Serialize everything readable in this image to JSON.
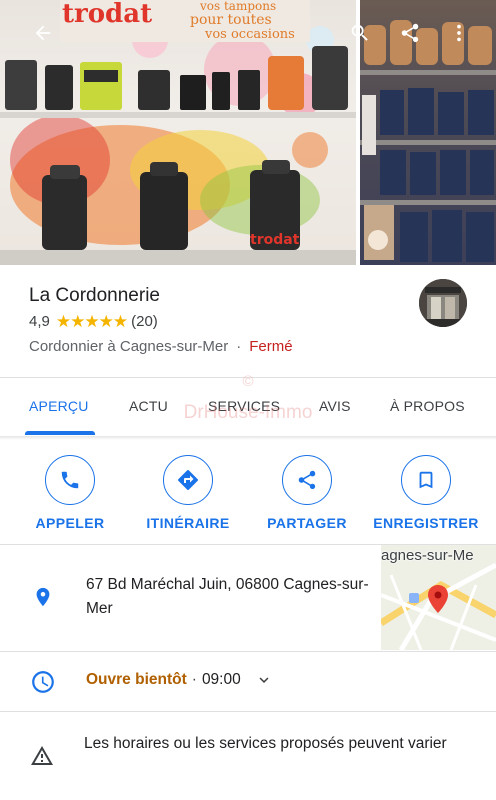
{
  "photos": {
    "sign_brand": "trodat",
    "sign_line1": "vos tampons",
    "sign_line2": "pour toutes",
    "sign_line3": "vos occasions",
    "bottom_brand": "trodat"
  },
  "place": {
    "name": "La Cordonnerie",
    "rating": "4,9",
    "stars": 5,
    "review_count": "(20)",
    "category": "Cordonnier à Cagnes-sur-Mer",
    "separator": "·",
    "status": "Fermé"
  },
  "tabs": [
    {
      "label": "APERÇU",
      "active": true
    },
    {
      "label": "ACTU",
      "active": false
    },
    {
      "label": "SERVICES",
      "active": false
    },
    {
      "label": "AVIS",
      "active": false
    },
    {
      "label": "À PROPOS",
      "active": false
    }
  ],
  "watermark": {
    "symbol": "©",
    "text": "DrHouse-Immo"
  },
  "actions": [
    {
      "label": "APPELER",
      "icon": "phone-icon"
    },
    {
      "label": "ITINÉRAIRE",
      "icon": "directions-icon"
    },
    {
      "label": "PARTAGER",
      "icon": "share-icon"
    },
    {
      "label": "ENREGISTRER",
      "icon": "bookmark-icon"
    }
  ],
  "address": {
    "text": "67 Bd Maréchal Juin, 06800 Cagnes-sur-Mer",
    "map_label": "agnes-sur-Me"
  },
  "hours": {
    "status": "Ouvre bientôt",
    "separator": "·",
    "time": "09:00"
  },
  "notice": {
    "text": "Les horaires ou les services proposés peuvent varier"
  },
  "colors": {
    "accent": "#1a73e8",
    "closed": "#c5221f",
    "opens_soon": "#b06000",
    "star": "#f5b400"
  }
}
